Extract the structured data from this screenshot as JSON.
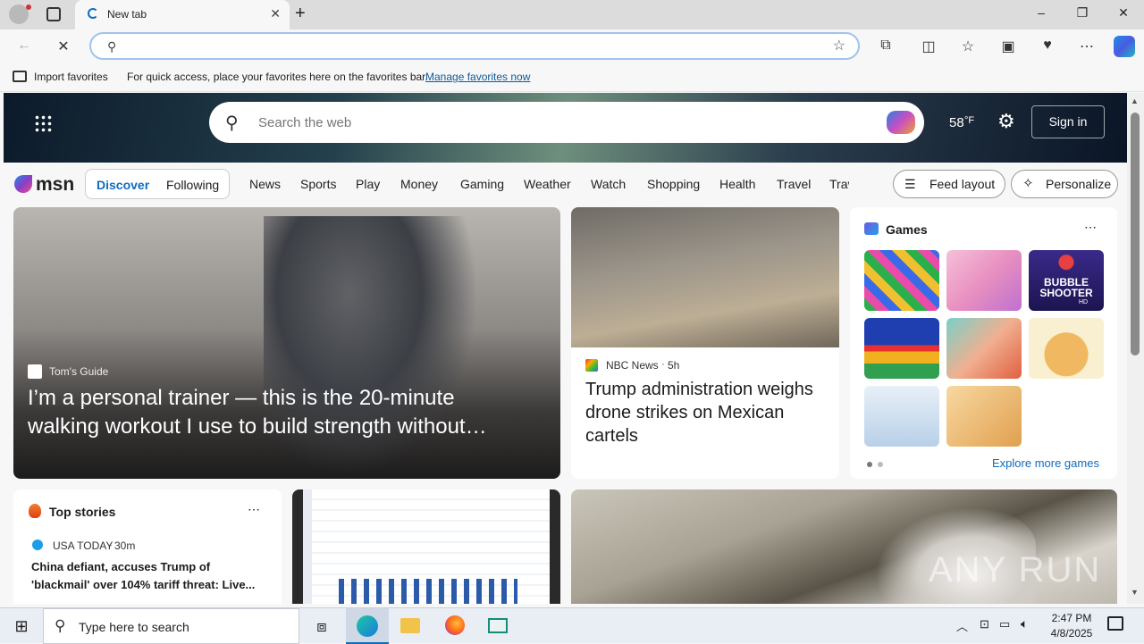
{
  "browser": {
    "tab_title": "New tab",
    "address_value": "",
    "fav_import": "Import favorites",
    "fav_prompt": "For quick access, place your favorites here on the favorites bar.",
    "fav_link": "Manage favorites now"
  },
  "msn": {
    "search_placeholder": "Search the web",
    "temperature": "58",
    "temp_unit": "°F",
    "sign_in": "Sign in",
    "logo": "msn",
    "tabs": [
      "Discover",
      "Following"
    ],
    "nav": [
      "News",
      "Sports",
      "Play",
      "Money",
      "Gaming",
      "Weather",
      "Watch",
      "Shopping",
      "Health",
      "Travel",
      "Trav"
    ],
    "feed_layout": "Feed layout",
    "personalize": "Personalize"
  },
  "hero": {
    "source": "Tom's Guide",
    "headline": "I’m a personal trainer — this is the 20-minute walking workout I use to build strength without…"
  },
  "news2": {
    "source": "NBC News",
    "age": "5h",
    "headline": "Trump administration weighs drone strikes on Mexican cartels"
  },
  "games": {
    "title": "Games",
    "more": "Explore more games",
    "tile3_label": "BUBBLE SHOOTER",
    "tile3_sub": "HD"
  },
  "top_stories": {
    "title": "Top stories",
    "source": "USA TODAY",
    "age": "30m",
    "headline": "China defiant, accuses Trump of 'blackmail' over 104% tariff threat: Live..."
  },
  "watermark": "ANY RUN",
  "taskbar": {
    "search_placeholder": "Type here to search",
    "time": "2:47 PM",
    "date": "4/8/2025"
  },
  "colors": {
    "accent": "#0f6cbd",
    "link": "#0c5a9e"
  }
}
